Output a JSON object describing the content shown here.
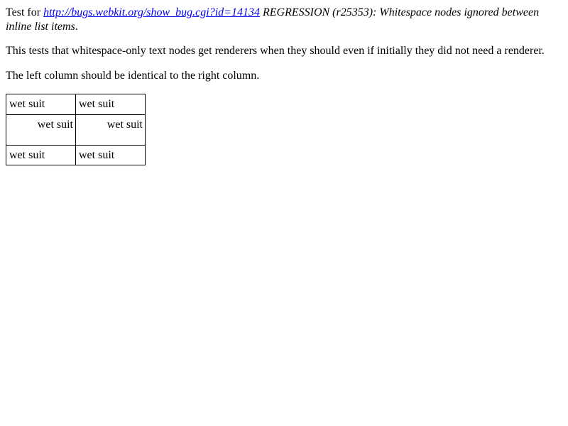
{
  "intro": {
    "prefix": "Test for ",
    "link_text": "http://bugs.webkit.org/show_bug.cgi?id=14134",
    "title_suffix": " REGRESSION (r25353): Whitespace nodes ignored between inline list items",
    "end": "."
  },
  "description": "This tests that whitespace-only text nodes get renderers when they should even if initially they did not need a renderer.",
  "instruction": "The left column should be identical to the right column.",
  "columns": {
    "left": [
      "wet suit",
      "wet suit",
      "wet suit"
    ],
    "right": [
      "wet suit",
      "wet suit",
      "wet suit"
    ]
  }
}
